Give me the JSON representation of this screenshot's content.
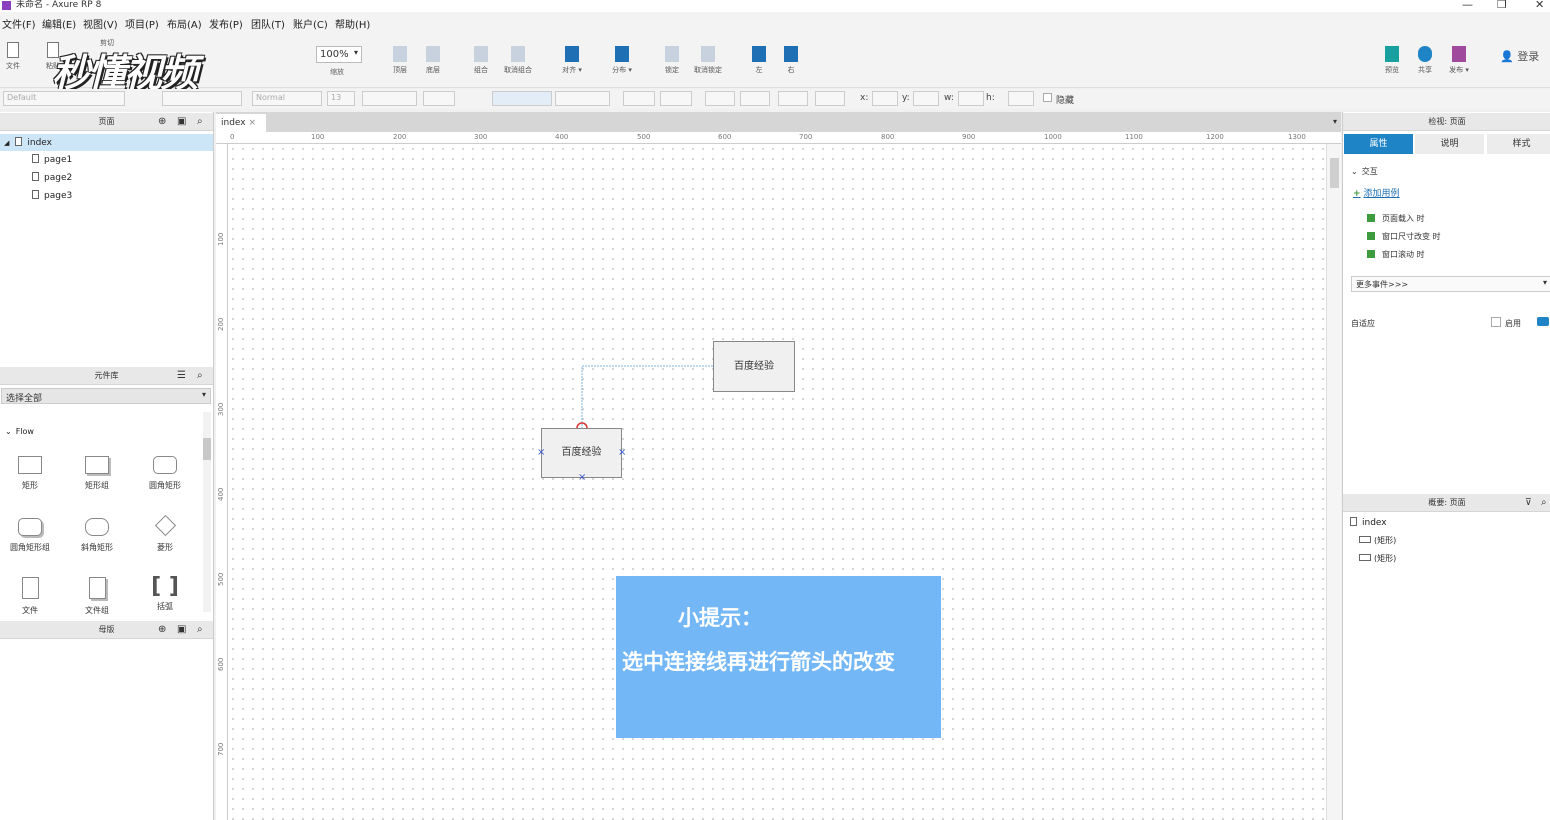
{
  "window": {
    "title": "未命名 - Axure RP 8",
    "min": "—",
    "restore": "❐",
    "close": "✕"
  },
  "menu": [
    "文件(F)",
    "编辑(E)",
    "视图(V)",
    "项目(P)",
    "布局(A)",
    "发布(P)",
    "团队(T)",
    "账户(C)",
    "帮助(H)"
  ],
  "toolbar": {
    "file_label": "文件",
    "paste_label": "粘贴",
    "cut_label": "剪切",
    "zoom_value": "100%",
    "zoom_label": "缩放",
    "top_label": "顶层",
    "bottom_label": "底层",
    "group_label": "组合",
    "ungroup_label": "取消组合",
    "align_label": "对齐 ▾",
    "distribute_label": "分布 ▾",
    "lock_label": "锁定",
    "unlock_label": "取消锁定",
    "left_label": "左",
    "right_label": "右",
    "preview_label": "预览",
    "share_label": "共享",
    "publish_label": "发布 ▾",
    "login_label": "登录",
    "watermark": "秒懂视频"
  },
  "formatbar": {
    "style_value": "Default",
    "font_style": "Normal",
    "font_size": "13",
    "x_label": "x:",
    "y_label": "y:",
    "w_label": "w:",
    "h_label": "h:",
    "hide_label": "隐藏"
  },
  "pages_panel": {
    "title": "页面",
    "items": [
      {
        "label": "index",
        "selected": true
      },
      {
        "label": "page1"
      },
      {
        "label": "page2"
      },
      {
        "label": "page3"
      }
    ]
  },
  "library_panel": {
    "title": "元件库",
    "select_value": "选择全部",
    "group_label": "Flow",
    "items": [
      "矩形",
      "矩形组",
      "圆角矩形",
      "圆角矩形组",
      "斜角矩形",
      "菱形",
      "文件",
      "文件组",
      "括弧"
    ]
  },
  "masters_panel": {
    "title": "母版"
  },
  "canvas": {
    "tab_label": "index",
    "ruler_top": [
      "0",
      "100",
      "200",
      "300",
      "400",
      "500",
      "600",
      "700",
      "800",
      "900",
      "1000",
      "1100",
      "1200",
      "1300"
    ],
    "ruler_left": [
      "100",
      "200",
      "300",
      "400",
      "500",
      "600",
      "700"
    ],
    "shape1_label": "百度经验",
    "shape2_label": "百度经验",
    "tip_title": "小提示：",
    "tip_body": "选中连接线再进行箭头的改变"
  },
  "inspector": {
    "title": "检视: 页面",
    "tabs": [
      "属性",
      "说明",
      "样式"
    ],
    "section_label": "交互",
    "add_case_label": "添加用例",
    "events": [
      "页面载入 时",
      "窗口尺寸改变 时",
      "窗口滚动 时"
    ],
    "more_events_value": "更多事件>>>",
    "adaptive_label": "自适应",
    "enable_label": "启用"
  },
  "outline": {
    "title": "概要: 页面",
    "root_label": "index",
    "items": [
      "(矩形)",
      "(矩形)"
    ]
  }
}
